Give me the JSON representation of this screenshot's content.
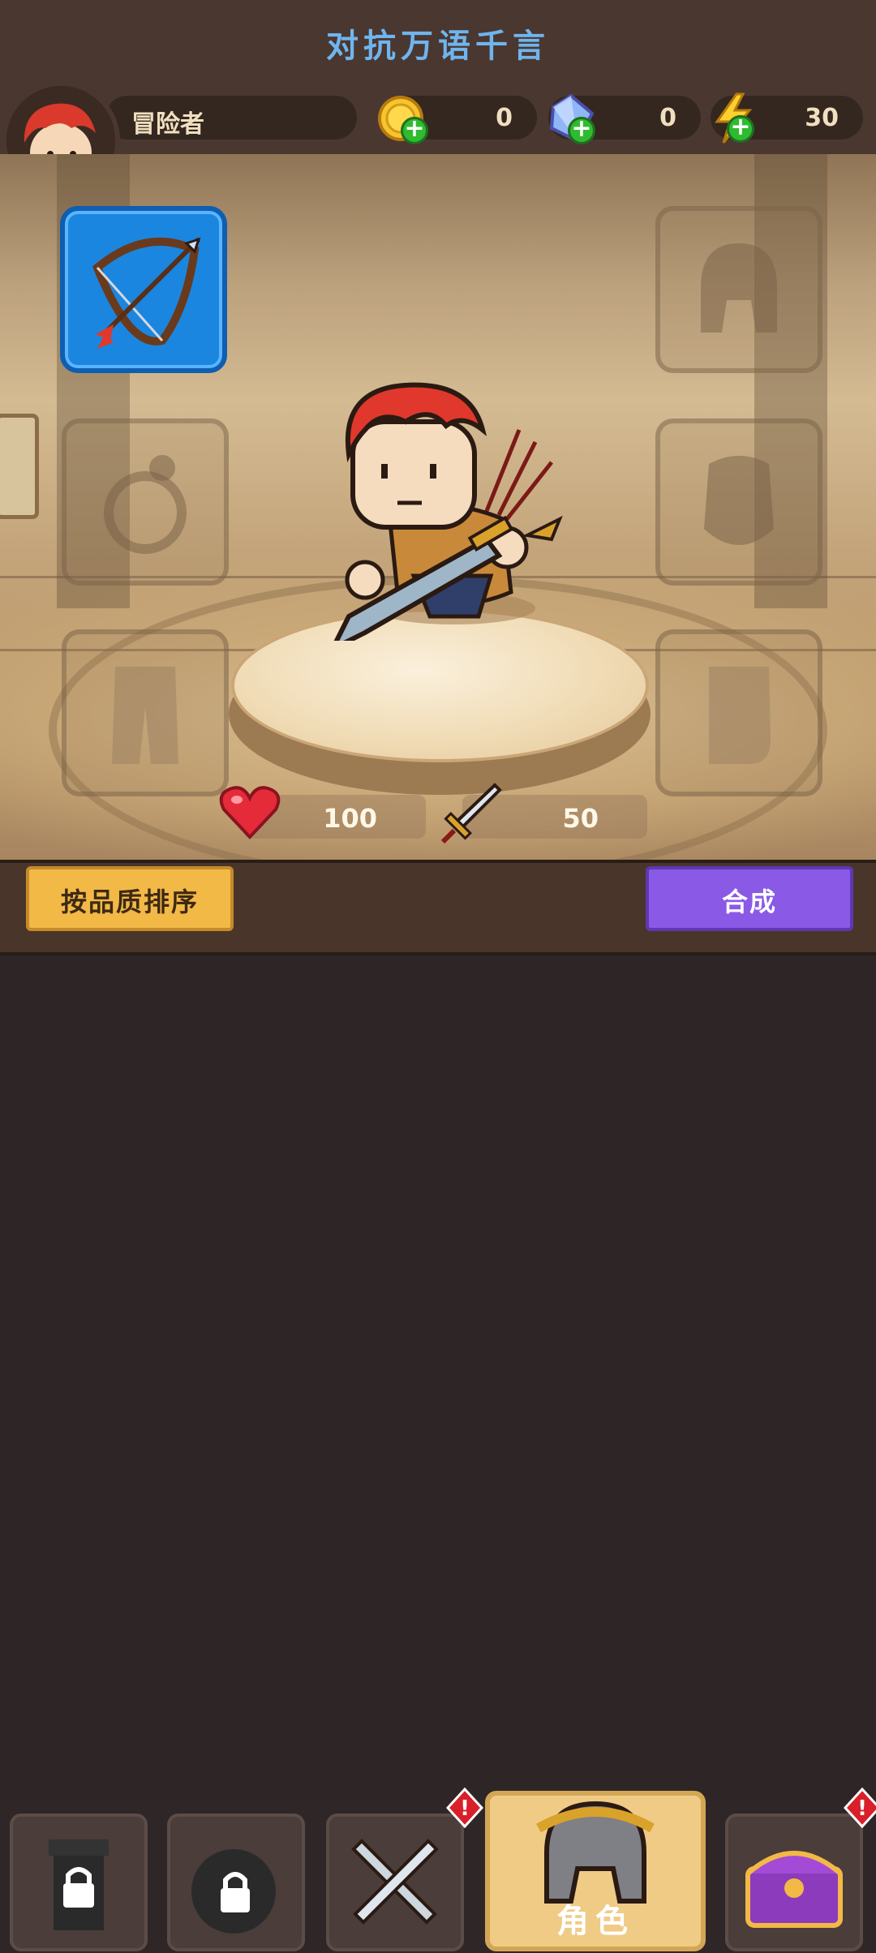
{
  "header": {
    "title": "对抗万语千言"
  },
  "player": {
    "name": "冒险者"
  },
  "resources": {
    "gold": {
      "icon": "gold-coin-icon",
      "value": "0"
    },
    "gems": {
      "icon": "crystal-gem-icon",
      "value": "0"
    },
    "energy": {
      "icon": "lightning-bolt-icon",
      "value": "30"
    }
  },
  "equipment_slots": [
    {
      "slot": "weapon",
      "icon": "bow-and-arrow-icon",
      "equipped": true
    },
    {
      "slot": "helmet",
      "icon": "helmet-icon",
      "equipped": false
    },
    {
      "slot": "ring",
      "icon": "ring-icon",
      "equipped": false
    },
    {
      "slot": "armor",
      "icon": "armor-icon",
      "equipped": false
    },
    {
      "slot": "pants",
      "icon": "pants-icon",
      "equipped": false
    },
    {
      "slot": "boots",
      "icon": "boots-icon",
      "equipped": false
    }
  ],
  "stats": {
    "health": {
      "icon": "heart-icon",
      "value": "100"
    },
    "attack": {
      "icon": "sword-icon",
      "value": "50"
    }
  },
  "actions": {
    "sort_label": "按品质排序",
    "merge_label": "合成"
  },
  "bottom_nav": {
    "tabs": [
      {
        "icon": "locked-tower-icon",
        "locked": true
      },
      {
        "icon": "locked-bomb-icon",
        "locked": true
      },
      {
        "icon": "crossed-swords-icon",
        "alert": true
      },
      {
        "icon": "helmet-icon",
        "label": "角色",
        "active": true
      },
      {
        "icon": "treasure-chest-icon",
        "alert": true
      }
    ]
  },
  "colors": {
    "title_blue": "#6fb5ee",
    "active_slot_blue": "#1b86e0",
    "merge_purple": "#8a5ae6",
    "sort_yellow": "#f2b947",
    "alert_red": "#d91f2a"
  }
}
